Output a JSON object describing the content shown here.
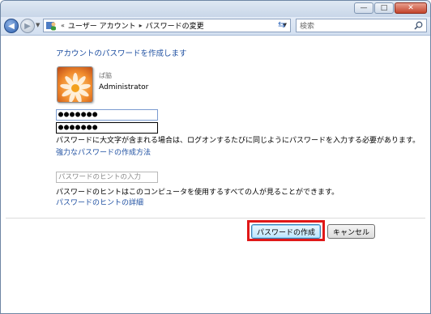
{
  "window": {
    "caption": {
      "minimize": "—",
      "maximize": "□",
      "close": "✕"
    }
  },
  "nav": {
    "breadcrumb_overflow": "«",
    "crumbs": [
      "ユーザー アカウント",
      "パスワードの変更"
    ],
    "search_placeholder": "検索"
  },
  "main": {
    "heading": "アカウントのパスワードを作成します",
    "user": {
      "name": "ぱ脇",
      "role": "Administrator"
    },
    "password_new": "●●●●●●●",
    "password_confirm": "●●●●●●●",
    "caps_note": "パスワードに大文字が含まれる場合は、ログオンするたびに同じようにパスワードを入力する必要があります。",
    "strong_password_link": "強力なパスワードの作成方法",
    "hint_placeholder": "パスワードのヒントの入力",
    "hint_note": "パスワードのヒントはこのコンピュータを使用するすべての人が見ることができます。",
    "hint_details_link": "パスワードのヒントの詳細"
  },
  "actions": {
    "create_label": "パスワードの作成",
    "cancel_label": "キャンセル"
  },
  "colors": {
    "link": "#1e4fa1",
    "highlight": "#e01818",
    "close_button": "#c3442c"
  }
}
